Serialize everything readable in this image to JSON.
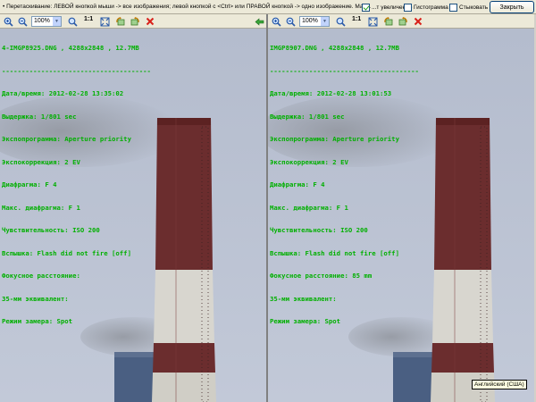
{
  "topbar": {
    "hint": "• Перетаскивание: ЛЕВОЙ кнопкой мыши -> все изображения; левой кнопкой с <Ctrl> или ПРАВОЙ кнопкой -> одно изображение. Мас...",
    "checkboxes": [
      {
        "label": "...т увеличение",
        "checked": true
      },
      {
        "label": "Гистограмма",
        "checked": false
      },
      {
        "label": "Стыковать",
        "checked": false
      }
    ],
    "close_label": "Закрыть"
  },
  "panes": [
    {
      "zoom": "100%",
      "one_to_one": "1:1",
      "info": [
        "4-IMGP8925.DNG , 4288x2848 , 12.7MB",
        "--------------------------------------",
        "Дата/время: 2012-02-28 13:35:02",
        "Выдержка: 1/801 sec",
        "Экспопрограмма: Aperture priority",
        "Экспокоррекция: 2 EV",
        "Диафрагма: F 4",
        "Макс. диафрагма: F 1",
        "Чувствительность: ISO 200",
        "Вспышка: Flash did not fire [off]",
        "Фокусное расстояние:",
        "35-мм эквивалент:",
        "Режим замера: Spot"
      ]
    },
    {
      "zoom": "100%",
      "one_to_one": "1:1",
      "info": [
        "IMGP8907.DNG , 4288x2848 , 12.7MB",
        "--------------------------------------",
        "Дата/время: 2012-02-28 13:01:53",
        "Выдержка: 1/801 sec",
        "Экспопрограмма: Aperture priority",
        "Экспокоррекция: 2 EV",
        "Диафрагма: F 4",
        "Макс. диафрагма: F 1",
        "Чувствительность: ISO 200",
        "Вспышка: Flash did not fire [off]",
        "Фокусное расстояние: 85 mm",
        "35-мм эквивалент:",
        "Режим замера: Spot"
      ]
    }
  ],
  "tooltip": "Английский (США)",
  "icons": {
    "zoom_in": "zoom-in-icon",
    "zoom_out": "zoom-out-icon",
    "fit": "fit-window-icon",
    "rotate_left": "rotate-left-icon",
    "rotate_right": "rotate-right-icon",
    "close": "close-icon",
    "back": "back-arrow-icon"
  },
  "colors": {
    "info_text": "#00b000",
    "sky": "#b7bfd4",
    "chimney_red": "#6b2d2e",
    "chimney_white": "#d8d6cf"
  }
}
